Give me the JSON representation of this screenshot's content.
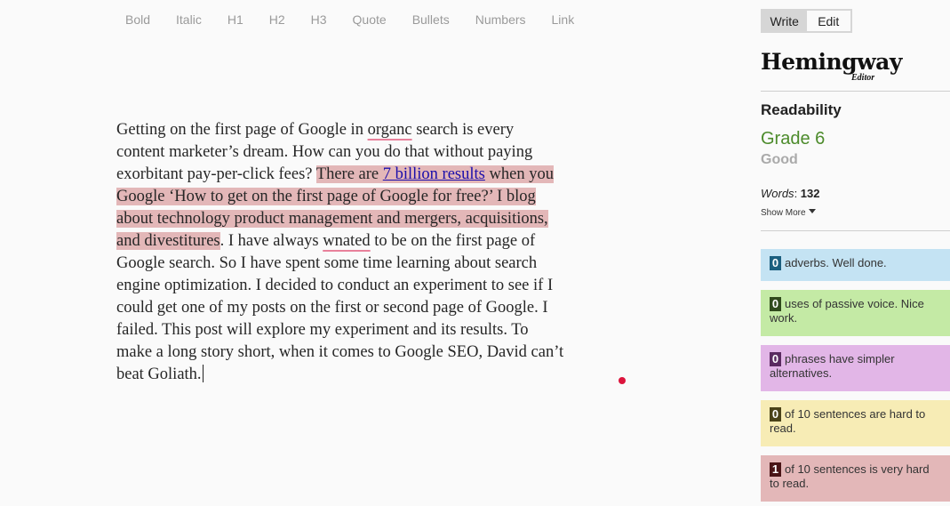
{
  "toolbar": {
    "bold": "Bold",
    "italic": "Italic",
    "h1": "H1",
    "h2": "H2",
    "h3": "H3",
    "quote": "Quote",
    "bullets": "Bullets",
    "numbers": "Numbers",
    "link": "Link"
  },
  "editor": {
    "l1a": "Getting on the first page of Google in ",
    "l1b": "organc",
    "l1c": " search is every",
    "l2": "content marketer’s dream.  How can you do that without paying",
    "l3a": "exorbitant pay-per-click fees? ",
    "l3b": " There are ",
    "l3link": "7 billion results",
    "l3c": " when you",
    "l4": "Google ‘How to get on the first page of Google for free?’ I blog",
    "l5": "about technology product management and mergers, acquisitions,",
    "l6a": "and divestitures",
    "l6b": ".  I have always ",
    "l6c": "wnated",
    "l6d": " to be on the first page of",
    "l7": "Google search. So I have spent some time learning about search",
    "l8": "engine optimization.  I decided to conduct an experiment to see if I",
    "l9": "could get one of my posts on the first or second page of Google.  I",
    "l10": "failed.  This post will explore my experiment and its results.  To",
    "l11": "make a long story short, when it comes to Google SEO, David can’t",
    "l12": "beat Goliath."
  },
  "sidebar": {
    "mode_write": "Write",
    "mode_edit": "Edit",
    "logo": "Hemingway",
    "logo_sub": "Editor",
    "readability_title": "Readability",
    "grade": "Grade 6",
    "grade_desc": "Good",
    "words_label": "Words",
    "words_sep": ": ",
    "words_count": "132",
    "show_more": "Show More",
    "stats": [
      {
        "count": "0",
        "text": "adverbs. Well done.",
        "bg": "#c4e3f3",
        "badge": "#1c5f7f"
      },
      {
        "count": "0",
        "text": "uses of passive voice. Nice work.",
        "bg": "#c4eaa5",
        "badge": "#2f4a1c"
      },
      {
        "count": "0",
        "text": "phrases have simpler alternatives.",
        "bg": "#e2b6e7",
        "badge": "#5a2a60"
      },
      {
        "count": "0",
        "text": "of 10 sentences are hard to read.",
        "bg": "#f7ecb5",
        "badge": "#4a4218"
      },
      {
        "count": "1",
        "text": "of 10 sentences is very hard to read.",
        "bg": "#e3b7b8",
        "badge": "#4a1517"
      }
    ]
  },
  "colors": {
    "grade": "#4c8b2b",
    "very_hard_highlight": "#e3b7b8",
    "spell_underline": "#e8819b",
    "link": "#1a0dab",
    "cursor_dot": "#dc143c"
  },
  "icons": {
    "show_more": "caret-down-icon",
    "cursor_marker": "red-dot-icon"
  }
}
